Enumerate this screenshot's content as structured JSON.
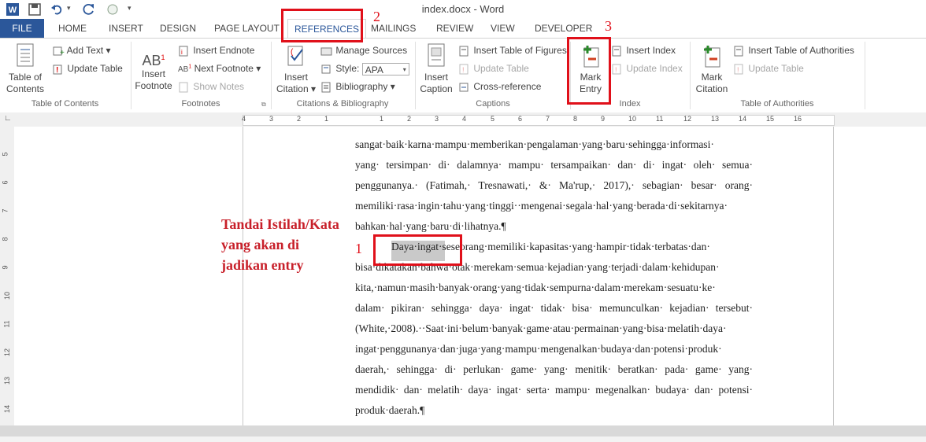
{
  "window": {
    "title": "index.docx - Word"
  },
  "tabs": [
    "FILE",
    "HOME",
    "INSERT",
    "DESIGN",
    "PAGE LAYOUT",
    "REFERENCES",
    "MAILINGS",
    "REVIEW",
    "VIEW",
    "DEVELOPER"
  ],
  "active_tab": "REFERENCES",
  "ribbon": {
    "toc": {
      "big": "Table of Contents",
      "add_text": "Add Text",
      "update_table": "Update Table",
      "label": "Table of Contents"
    },
    "footnotes": {
      "big_icon_text": "AB",
      "big": "Insert Footnote",
      "insert_endnote": "Insert Endnote",
      "next_footnote": "Next Footnote",
      "show_notes": "Show Notes",
      "label": "Footnotes"
    },
    "citations": {
      "big": "Insert Citation",
      "manage_sources": "Manage Sources",
      "style_label": "Style:",
      "style_value": "APA",
      "bibliography": "Bibliography",
      "label": "Citations & Bibliography"
    },
    "captions": {
      "big": "Insert Caption",
      "insert_tof": "Insert Table of Figures",
      "update_table": "Update Table",
      "cross_reference": "Cross-reference",
      "label": "Captions"
    },
    "index": {
      "big": "Mark Entry",
      "insert_index": "Insert Index",
      "update_index": "Update Index",
      "label": "Index"
    },
    "toa": {
      "big": "Mark Citation",
      "insert_toa": "Insert Table of Authorities",
      "update_table": "Update Table",
      "label": "Table of Authorities"
    }
  },
  "ruler": {
    "h_numbers": [
      "4",
      "3",
      "2",
      "1",
      "1",
      "2",
      "3",
      "4",
      "5",
      "6",
      "7",
      "8",
      "9",
      "10",
      "11",
      "12",
      "13",
      "14",
      "15",
      "16"
    ],
    "v_numbers": [
      "5",
      "6",
      "7",
      "8",
      "9",
      "10",
      "11",
      "12",
      "13",
      "14"
    ]
  },
  "document": {
    "lines": [
      "sangat·baik·karna·mampu·memberikan·pengalaman·yang·baru·sehingga·informasi·",
      "yang· tersimpan· di· dalamnya· mampu· tersampaikan· dan· di· ingat· oleh· semua·",
      "penggunanya.· (Fatimah,· Tresnawati,· &· Ma'rup,· 2017),· sebagian· besar· orang·",
      "memiliki·rasa·ingin·tahu·yang·tinggi··mengenai·segala·hal·yang·berada·di·sekitarnya·",
      "bahkan·hal·yang·baru·di·lihatnya.¶",
      "Daya·ingat·seseorang·memiliki·kapasitas·yang·hampir·tidak·terbatas·dan·",
      "bisa·dikatakan·bahwa·otak·merekam·semua·kejadian·yang·terjadi·dalam·kehidupan·",
      "kita,·namun·masih·banyak·orang·yang·tidak·sempurna·dalam·merekam·sesuatu·ke·",
      "dalam· pikiran· sehingga· daya· ingat· tidak· bisa· memunculkan· kejadian· tersebut·",
      "(White,·2008).··Saat·ini·belum·banyak·game·atau·permainan·yang·bisa·melatih·daya·",
      "ingat·penggunanya·dan·juga·yang·mampu·mengenalkan·budaya·dan·potensi·produk·",
      "daerah,· sehingga· di· perlukan· game· yang· menitik· beratkan· pada· game· yang·",
      "mendidik· dan· melatih· daya· ingat· serta· mampu· megenalkan· budaya· dan· potensi·",
      "produk·daerah.¶"
    ]
  },
  "annotations": {
    "note": "Tandai Istilah/Kata yang akan di jadikan entry",
    "num1": "1",
    "num2": "2",
    "num3": "3"
  },
  "colors": {
    "accent": "#2b579a",
    "annotation_red": "#e0101a"
  }
}
